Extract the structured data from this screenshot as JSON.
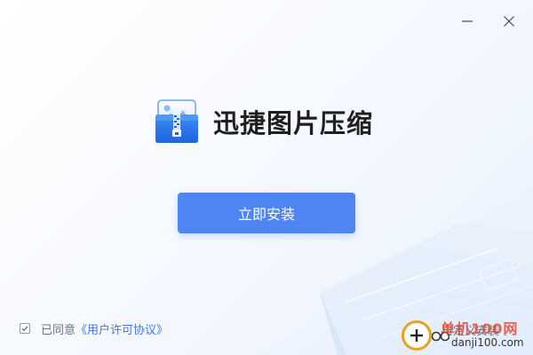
{
  "window": {
    "minimize_icon": "minimize-icon",
    "close_icon": "close-icon"
  },
  "app": {
    "name": "迅捷图片压缩",
    "logo_icon": "zip-folder-image-icon"
  },
  "install_button": {
    "label": "立即安装"
  },
  "agreement": {
    "checked": true,
    "text": "已同意",
    "link": "《用户许可协议》"
  },
  "custom_install": {
    "label": "自定义安装"
  },
  "watermark": {
    "title": "单机100网",
    "url": "danji100.com"
  },
  "colors": {
    "accent": "#4d85f2",
    "link": "#3f7ae8",
    "text_muted": "#6b7280",
    "title": "#1f1f1f",
    "watermark_red": "#e5442f"
  }
}
